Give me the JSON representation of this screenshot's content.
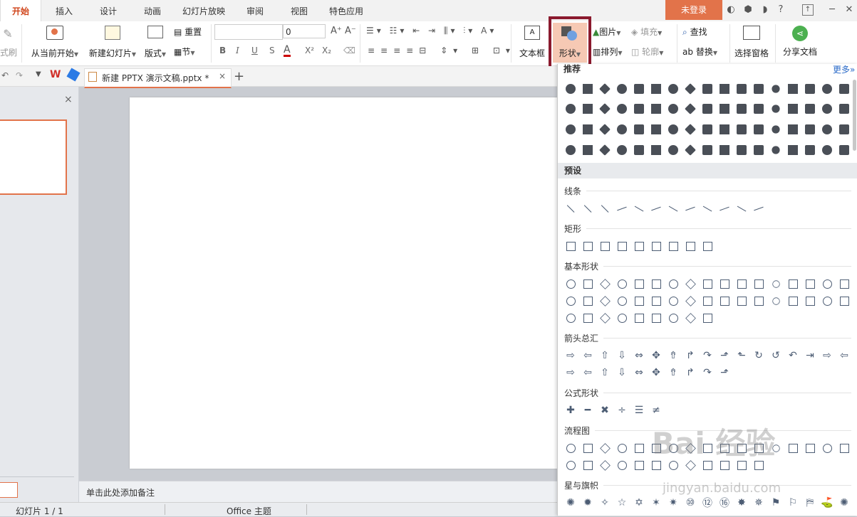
{
  "tabs": [
    "开始",
    "插入",
    "设计",
    "动画",
    "幻灯片放映",
    "审阅",
    "视图",
    "特色应用"
  ],
  "login_label": "未登录",
  "help_label": "?",
  "ribbon": {
    "format_painter": "式刷",
    "from_current": "从当前开始",
    "new_slide": "新建幻灯片",
    "layout": "版式",
    "reset": "重置",
    "section": "节",
    "font_size": "0",
    "textbox": "文本框",
    "shapes": "形状",
    "picture": "图片",
    "fill": "填充",
    "arrange": "排列",
    "outline": "轮廓",
    "find": "查找",
    "replace": "替换",
    "select_pane": "选择窗格",
    "share": "分享文档",
    "bold": "B",
    "italic": "I",
    "underline": "U",
    "strike": "S",
    "fontcolor": "A",
    "superscript": "X²",
    "subscript": "X₂"
  },
  "doc_tab": {
    "title": "新建 PPTX 演示文稿.pptx *",
    "close": "×",
    "add": "+"
  },
  "left_panel": {
    "close": "×"
  },
  "notes_placeholder": "单击此处添加备注",
  "status": {
    "slide": "幻灯片 1 / 1",
    "theme": "Office 主题"
  },
  "dropdown": {
    "recommended": "推荐",
    "more": "更多»",
    "preset": "预设",
    "categories": [
      "线条",
      "矩形",
      "基本形状",
      "箭头总汇",
      "公式形状",
      "流程图",
      "星与旗帜"
    ]
  },
  "watermark": "Bai 经验",
  "watermark_url": "jingyan.baidu.com"
}
